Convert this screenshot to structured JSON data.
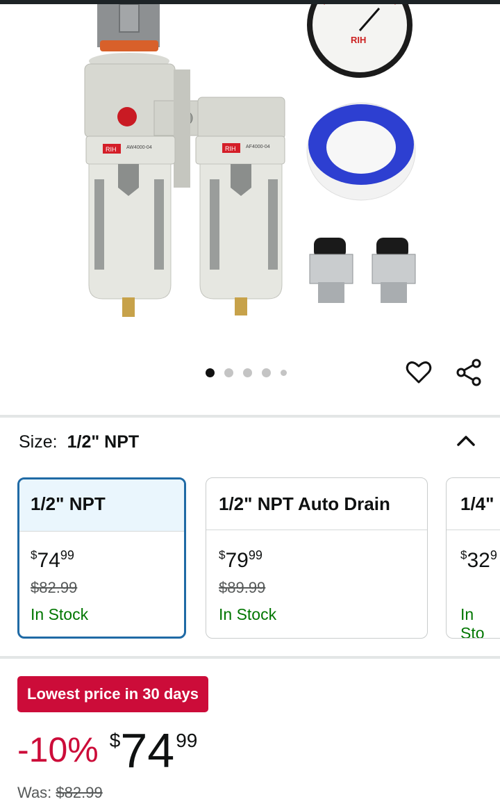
{
  "gallery": {
    "gauge_brand": "RIH",
    "label_left_brand": "RIH",
    "label_left_model": "AW4000-04",
    "label_right_brand": "RIH",
    "label_right_model": "AF4000-04",
    "dot_count": 5,
    "active_dot": 0
  },
  "actions": {
    "favorite_icon": "heart-icon",
    "share_icon": "share-icon"
  },
  "size": {
    "label": "Size:",
    "selected": "1/2\" NPT"
  },
  "options": [
    {
      "title": "1/2\" NPT",
      "currency": "$",
      "whole": "74",
      "cents": "99",
      "list_price": "$82.99",
      "availability": "In Stock",
      "selected": true
    },
    {
      "title": "1/2\" NPT Auto Drain",
      "currency": "$",
      "whole": "79",
      "cents": "99",
      "list_price": "$89.99",
      "availability": "In Stock",
      "selected": false
    },
    {
      "title": "1/4\"",
      "currency": "$",
      "whole": "32",
      "cents": "9",
      "list_price": "",
      "availability": "In Sto",
      "selected": false
    }
  ],
  "deal": {
    "badge": "Lowest price in 30 days",
    "discount": "-10%",
    "currency": "$",
    "whole": "74",
    "cents": "99",
    "was_label": "Was:",
    "was_price": "$82.99"
  },
  "colors": {
    "deal_red": "#cc0c39",
    "selected_border": "#1f6aa5",
    "in_stock_green": "#007600"
  }
}
